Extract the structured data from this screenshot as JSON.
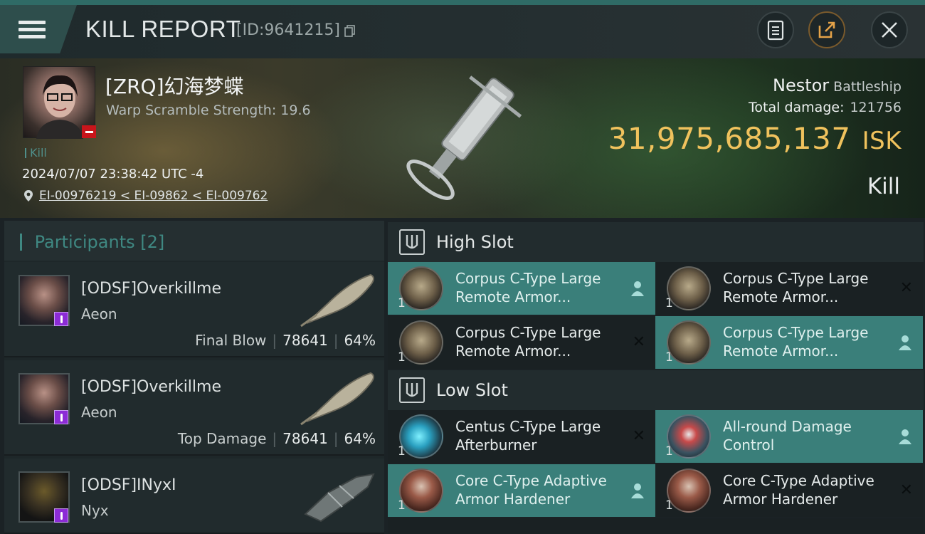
{
  "header": {
    "title": "KILL REPORT",
    "report_id": "[ID:9641215]",
    "icons": [
      "menu-icon",
      "copy-icon",
      "clipboard-icon",
      "share-icon",
      "close-icon"
    ]
  },
  "victim": {
    "name": "[ZRQ]幻海梦蝶",
    "warp": "Warp Scramble Strength: 19.6",
    "tag": "Kill",
    "datetime": "2024/07/07 23:38:42 UTC -4",
    "location": "EI-00976219 < EI-09862 < EI-009762",
    "ship_name": "Nestor",
    "ship_class": "Battleship",
    "total_damage_label": "Total damage:",
    "total_damage": "121756",
    "isk_value": "31,975,685,137",
    "isk_unit": "ISK",
    "result": "Kill"
  },
  "participants": {
    "title": "Participants",
    "count": "[2]",
    "rows": [
      {
        "name": "[ODSF]Overkillme",
        "ship": "Aeon",
        "role": "Final Blow",
        "damage": "78641",
        "percent": "64%"
      },
      {
        "name": "[ODSF]Overkillme",
        "ship": "Aeon",
        "role": "Top Damage",
        "damage": "78641",
        "percent": "64%"
      },
      {
        "name": "[ODSF]INyxI",
        "ship": "Nyx"
      }
    ]
  },
  "high_slot": {
    "label": "High Slot",
    "modules": [
      {
        "line1": "Corpus C-Type Large",
        "line2": "Remote Armor...",
        "qty": "1"
      },
      {
        "line1": "Corpus C-Type Large",
        "line2": "Remote Armor...",
        "qty": "1"
      },
      {
        "line1": "Corpus C-Type Large",
        "line2": "Remote Armor...",
        "qty": "1"
      },
      {
        "line1": "Corpus C-Type Large",
        "line2": "Remote Armor...",
        "qty": "1"
      }
    ]
  },
  "low_slot": {
    "label": "Low Slot",
    "modules": [
      {
        "line1": "Centus C-Type Large",
        "line2": "Afterburner",
        "qty": "1"
      },
      {
        "line1": "All-round Damage",
        "line2": "Control",
        "qty": "1"
      },
      {
        "line1": "Core C-Type Adaptive",
        "line2": "Armor Hardener",
        "qty": "1"
      },
      {
        "line1": "Core C-Type Adaptive",
        "line2": "Armor Hardener",
        "qty": "1"
      }
    ]
  },
  "colors": {
    "accent_teal": "#3a7f7a",
    "isk_gold": "#f0c25d",
    "badge_purple": "#8c2bd6",
    "badge_red": "#c8151b"
  }
}
